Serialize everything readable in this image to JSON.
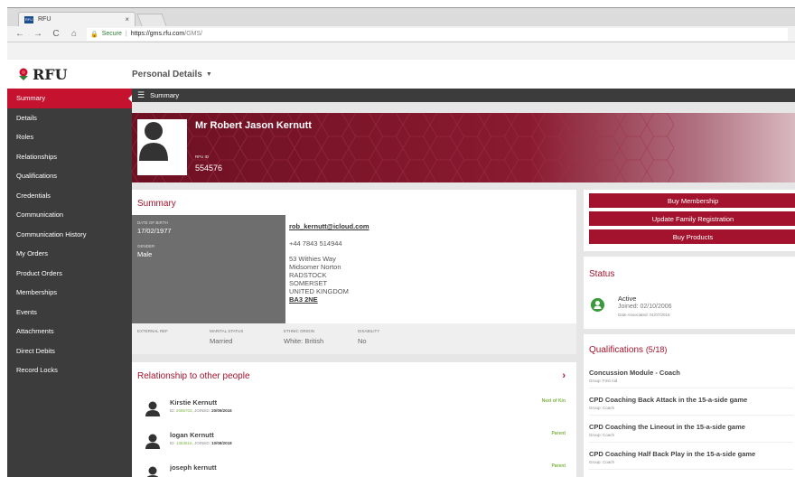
{
  "browser": {
    "tab_title": "RFU",
    "tab_close": "×",
    "favicon_text": "RFU",
    "secure_label": "Secure",
    "url_host": "https://gms.rfu.com",
    "url_path": "/GMS/"
  },
  "header": {
    "logo_text": "RFU",
    "page_title": "Personal Details"
  },
  "sidebar": {
    "items": [
      {
        "label": "Summary"
      },
      {
        "label": "Details"
      },
      {
        "label": "Roles"
      },
      {
        "label": "Relationships"
      },
      {
        "label": "Qualifications"
      },
      {
        "label": "Credentials"
      },
      {
        "label": "Communication"
      },
      {
        "label": "Communication History"
      },
      {
        "label": "My Orders"
      },
      {
        "label": "Product Orders"
      },
      {
        "label": "Memberships"
      },
      {
        "label": "Events"
      },
      {
        "label": "Attachments"
      },
      {
        "label": "Direct Debits"
      },
      {
        "label": "Record Locks"
      }
    ]
  },
  "subbar": {
    "title": "Summary"
  },
  "profile": {
    "name": "Mr Robert Jason Kernutt",
    "rfu_id_label": "RFU ID",
    "rfu_id": "554576"
  },
  "summary": {
    "title": "Summary",
    "dob_label": "DATE OF BIRTH",
    "dob": "17/02/1977",
    "gender_label": "GENDER",
    "gender": "Male",
    "email": "rob_kernutt@icloud.com",
    "phone": "+44 7843 514944",
    "address": [
      "53 Withies Way",
      "Midsomer Norton",
      "RADSTOCK",
      "SOMERSET",
      "UNITED KINGDOM"
    ],
    "postcode": "BA3 2NE",
    "external_ref_label": "EXTERNAL REF",
    "external_ref": "",
    "marital_label": "MARITAL STATUS",
    "marital": "Married",
    "ethnic_label": "ETHNIC ORIGIN",
    "ethnic": "White: British",
    "disability_label": "DISABILITY",
    "disability": "No"
  },
  "relationships": {
    "title": "Relationship to other people",
    "arrow": "›",
    "people": [
      {
        "name": "Kirstie Kernutt",
        "id_label": "ID:",
        "id": "2085703",
        "joined_label": "JOINED:",
        "joined": "20/09/2016",
        "type": "Next of Kin"
      },
      {
        "name": "logan Kernutt",
        "id_label": "ID:",
        "id": "1363816",
        "joined_label": "JOINED:",
        "joined": "10/08/2018",
        "type": "Parent"
      },
      {
        "name": "joseph kernutt",
        "id_label": "",
        "id": "",
        "joined_label": "",
        "joined": "",
        "type": "Parent"
      }
    ]
  },
  "actions": {
    "buy_membership": "Buy Membership",
    "update_family": "Update Family Registration",
    "buy_products": "Buy Products"
  },
  "status": {
    "title": "Status",
    "state": "Active",
    "joined": "Joined: 02/10/2006",
    "associated": "Date Associated: 01/07/2016"
  },
  "qualifications": {
    "title": "Qualifications",
    "count": "(5/18)",
    "items": [
      {
        "name": "Concussion Module - Coach",
        "group": "Group: First Aid"
      },
      {
        "name": "CPD Coaching Back Attack in the 15-a-side game",
        "group": "Group: Coach"
      },
      {
        "name": "CPD Coaching the Lineout in the 15-a-side game",
        "group": "Group: Coach"
      },
      {
        "name": "CPD Coaching Half Back Play in the 15-a-side game",
        "group": "Group: Coach"
      }
    ]
  },
  "colors": {
    "brand": "#c4122f",
    "accent": "#a3132d",
    "sidebar": "#3c3c3c",
    "success": "#3c9a3c"
  }
}
